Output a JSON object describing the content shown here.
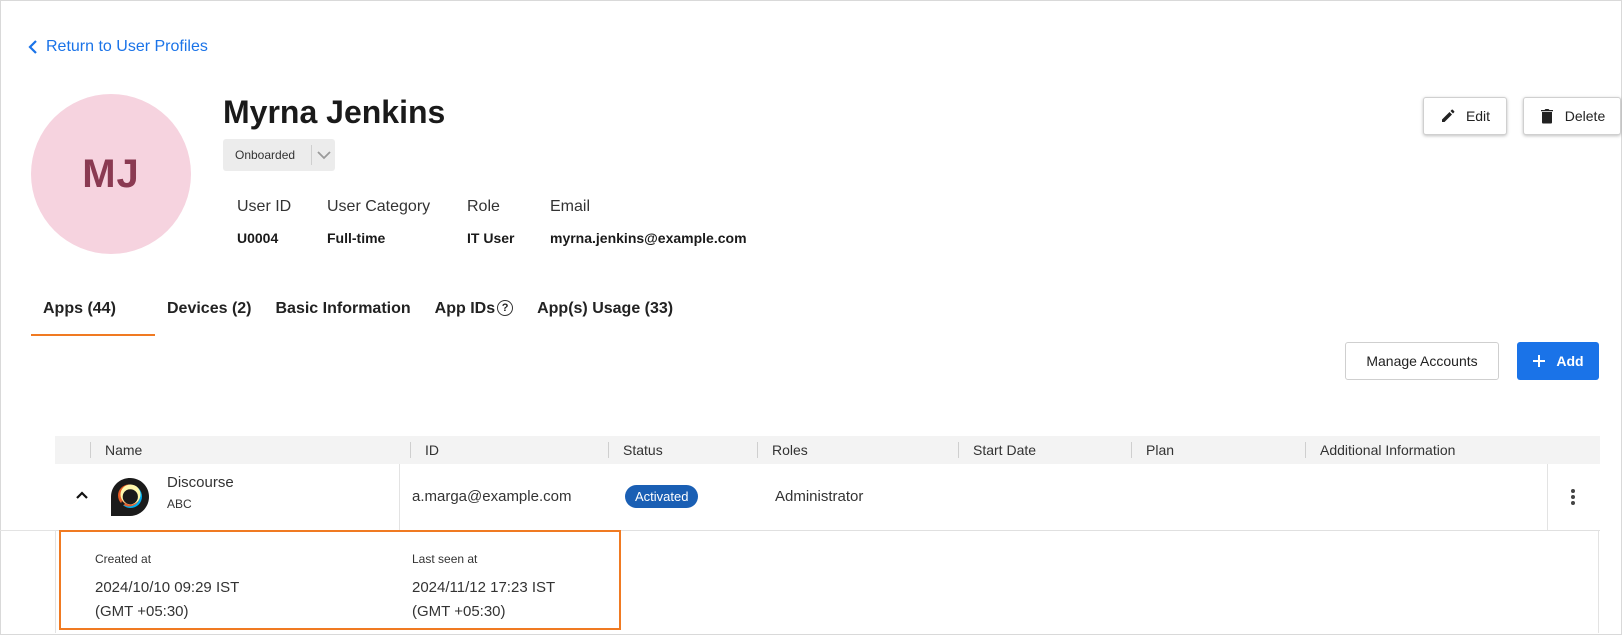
{
  "back_link": {
    "label": "Return to User Profiles"
  },
  "profile": {
    "initials": "MJ",
    "name": "Myrna Jenkins",
    "status": "Onboarded",
    "fields": [
      {
        "key": "User ID",
        "value": "U0004"
      },
      {
        "key": "User Category",
        "value": "Full-time"
      },
      {
        "key": "Role",
        "value": "IT User"
      },
      {
        "key": "Email",
        "value": "myrna.jenkins@example.com"
      }
    ]
  },
  "actions": {
    "edit": "Edit",
    "delete": "Delete"
  },
  "tabs": [
    {
      "label": "Apps (44)",
      "active": true
    },
    {
      "label": "Devices (2)",
      "active": false
    },
    {
      "label": "Basic Information",
      "active": false
    },
    {
      "label": "App IDs",
      "active": false
    },
    {
      "label": "App(s) Usage (33)",
      "active": false
    }
  ],
  "toolbar": {
    "manage_accounts": "Manage Accounts",
    "add": "Add"
  },
  "table": {
    "columns": [
      "Name",
      "ID",
      "Status",
      "Roles",
      "Start Date",
      "Plan",
      "Additional Information"
    ],
    "rows": [
      {
        "app_name": "Discourse",
        "app_sub": "ABC",
        "id": "a.marga@example.com",
        "status": "Activated",
        "roles": "Administrator",
        "start_date": "",
        "plan": "",
        "additional_info": ""
      }
    ]
  },
  "details": {
    "created_label": "Created at",
    "created_value_line1": "2024/10/10 09:29 IST",
    "created_value_line2": "(GMT +05:30)",
    "last_seen_label": "Last seen at",
    "last_seen_value_line1": "2024/11/12 17:23 IST",
    "last_seen_value_line2": "(GMT +05:30)"
  },
  "colors": {
    "accent": "#1a73e8",
    "tab_indicator": "#f07a22",
    "status_badge": "#1a5fb4",
    "avatar_bg": "#f6d3df"
  }
}
